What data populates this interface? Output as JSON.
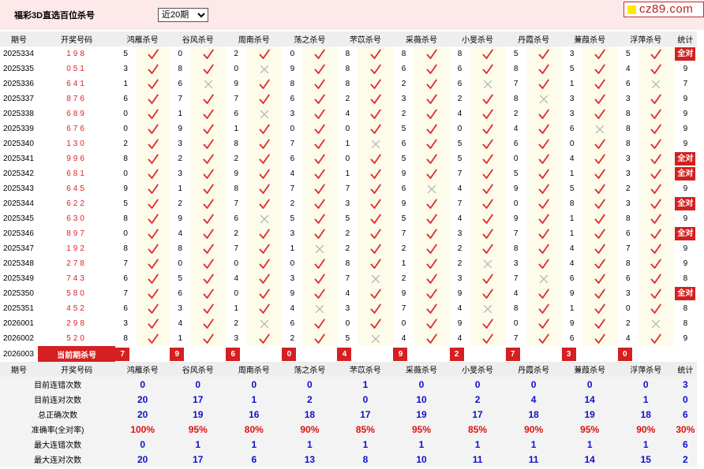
{
  "header": {
    "title": "福彩3D直选百位杀号",
    "range_selected": "近20期",
    "site": "cz89.com"
  },
  "columns": [
    "期号",
    "开奖号码",
    "鸿雁杀号",
    "谷风杀号",
    "周南杀号",
    "荡之杀号",
    "芣苡杀号",
    "采薇杀号",
    "小旻杀号",
    "丹霞杀号",
    "蒹葭杀号",
    "浮萍杀号",
    "统计"
  ],
  "rows": [
    {
      "period": "2025334",
      "code": "198",
      "kills": [
        [
          5,
          1
        ],
        [
          0,
          1
        ],
        [
          2,
          1
        ],
        [
          0,
          1
        ],
        [
          8,
          1
        ],
        [
          8,
          1
        ],
        [
          8,
          1
        ],
        [
          5,
          1
        ],
        [
          3,
          1
        ],
        [
          5,
          1
        ]
      ],
      "stat": "全对"
    },
    {
      "period": "2025335",
      "code": "051",
      "kills": [
        [
          3,
          1
        ],
        [
          8,
          1
        ],
        [
          0,
          0
        ],
        [
          9,
          1
        ],
        [
          8,
          1
        ],
        [
          6,
          1
        ],
        [
          6,
          1
        ],
        [
          8,
          1
        ],
        [
          5,
          1
        ],
        [
          4,
          1
        ]
      ],
      "stat": "9"
    },
    {
      "period": "2025336",
      "code": "641",
      "kills": [
        [
          1,
          1
        ],
        [
          6,
          0
        ],
        [
          9,
          1
        ],
        [
          8,
          1
        ],
        [
          8,
          1
        ],
        [
          2,
          1
        ],
        [
          6,
          0
        ],
        [
          7,
          1
        ],
        [
          1,
          1
        ],
        [
          6,
          0
        ]
      ],
      "stat": "7"
    },
    {
      "period": "2025337",
      "code": "876",
      "kills": [
        [
          6,
          1
        ],
        [
          7,
          1
        ],
        [
          7,
          1
        ],
        [
          6,
          1
        ],
        [
          2,
          1
        ],
        [
          3,
          1
        ],
        [
          2,
          1
        ],
        [
          8,
          0
        ],
        [
          3,
          1
        ],
        [
          3,
          1
        ]
      ],
      "stat": "9"
    },
    {
      "period": "2025338",
      "code": "689",
      "kills": [
        [
          0,
          1
        ],
        [
          1,
          1
        ],
        [
          6,
          0
        ],
        [
          3,
          1
        ],
        [
          4,
          1
        ],
        [
          2,
          1
        ],
        [
          4,
          1
        ],
        [
          2,
          1
        ],
        [
          3,
          1
        ],
        [
          8,
          1
        ]
      ],
      "stat": "9"
    },
    {
      "period": "2025339",
      "code": "676",
      "kills": [
        [
          0,
          1
        ],
        [
          9,
          1
        ],
        [
          1,
          1
        ],
        [
          0,
          1
        ],
        [
          0,
          1
        ],
        [
          5,
          1
        ],
        [
          0,
          1
        ],
        [
          4,
          1
        ],
        [
          6,
          0
        ],
        [
          8,
          1
        ]
      ],
      "stat": "9"
    },
    {
      "period": "2025340",
      "code": "130",
      "kills": [
        [
          2,
          1
        ],
        [
          3,
          1
        ],
        [
          8,
          1
        ],
        [
          7,
          1
        ],
        [
          1,
          0
        ],
        [
          6,
          1
        ],
        [
          5,
          1
        ],
        [
          6,
          1
        ],
        [
          0,
          1
        ],
        [
          8,
          1
        ]
      ],
      "stat": "9"
    },
    {
      "period": "2025341",
      "code": "996",
      "kills": [
        [
          8,
          1
        ],
        [
          2,
          1
        ],
        [
          2,
          1
        ],
        [
          6,
          1
        ],
        [
          0,
          1
        ],
        [
          5,
          1
        ],
        [
          5,
          1
        ],
        [
          0,
          1
        ],
        [
          4,
          1
        ],
        [
          3,
          1
        ]
      ],
      "stat": "全对"
    },
    {
      "period": "2025342",
      "code": "681",
      "kills": [
        [
          0,
          1
        ],
        [
          3,
          1
        ],
        [
          9,
          1
        ],
        [
          4,
          1
        ],
        [
          1,
          1
        ],
        [
          9,
          1
        ],
        [
          7,
          1
        ],
        [
          5,
          1
        ],
        [
          1,
          1
        ],
        [
          3,
          1
        ]
      ],
      "stat": "全对"
    },
    {
      "period": "2025343",
      "code": "645",
      "kills": [
        [
          9,
          1
        ],
        [
          1,
          1
        ],
        [
          8,
          1
        ],
        [
          7,
          1
        ],
        [
          7,
          1
        ],
        [
          6,
          0
        ],
        [
          4,
          1
        ],
        [
          9,
          1
        ],
        [
          5,
          1
        ],
        [
          2,
          1
        ]
      ],
      "stat": "9"
    },
    {
      "period": "2025344",
      "code": "622",
      "kills": [
        [
          5,
          1
        ],
        [
          2,
          1
        ],
        [
          7,
          1
        ],
        [
          2,
          1
        ],
        [
          3,
          1
        ],
        [
          9,
          1
        ],
        [
          7,
          1
        ],
        [
          0,
          1
        ],
        [
          8,
          1
        ],
        [
          3,
          1
        ]
      ],
      "stat": "全对"
    },
    {
      "period": "2025345",
      "code": "630",
      "kills": [
        [
          8,
          1
        ],
        [
          9,
          1
        ],
        [
          6,
          0
        ],
        [
          5,
          1
        ],
        [
          5,
          1
        ],
        [
          5,
          1
        ],
        [
          4,
          1
        ],
        [
          9,
          1
        ],
        [
          1,
          1
        ],
        [
          8,
          1
        ]
      ],
      "stat": "9"
    },
    {
      "period": "2025346",
      "code": "897",
      "kills": [
        [
          0,
          1
        ],
        [
          4,
          1
        ],
        [
          2,
          1
        ],
        [
          3,
          1
        ],
        [
          2,
          1
        ],
        [
          7,
          1
        ],
        [
          3,
          1
        ],
        [
          7,
          1
        ],
        [
          1,
          1
        ],
        [
          6,
          1
        ]
      ],
      "stat": "全对"
    },
    {
      "period": "2025347",
      "code": "192",
      "kills": [
        [
          8,
          1
        ],
        [
          8,
          1
        ],
        [
          7,
          1
        ],
        [
          1,
          0
        ],
        [
          2,
          1
        ],
        [
          2,
          1
        ],
        [
          2,
          1
        ],
        [
          8,
          1
        ],
        [
          4,
          1
        ],
        [
          7,
          1
        ]
      ],
      "stat": "9"
    },
    {
      "period": "2025348",
      "code": "278",
      "kills": [
        [
          7,
          1
        ],
        [
          0,
          1
        ],
        [
          0,
          1
        ],
        [
          0,
          1
        ],
        [
          8,
          1
        ],
        [
          1,
          1
        ],
        [
          2,
          0
        ],
        [
          3,
          1
        ],
        [
          4,
          1
        ],
        [
          8,
          1
        ]
      ],
      "stat": "9"
    },
    {
      "period": "2025349",
      "code": "743",
      "kills": [
        [
          6,
          1
        ],
        [
          5,
          1
        ],
        [
          4,
          1
        ],
        [
          3,
          1
        ],
        [
          7,
          0
        ],
        [
          2,
          1
        ],
        [
          3,
          1
        ],
        [
          7,
          0
        ],
        [
          6,
          1
        ],
        [
          6,
          1
        ]
      ],
      "stat": "8"
    },
    {
      "period": "2025350",
      "code": "580",
      "kills": [
        [
          7,
          1
        ],
        [
          6,
          1
        ],
        [
          0,
          1
        ],
        [
          9,
          1
        ],
        [
          4,
          1
        ],
        [
          9,
          1
        ],
        [
          9,
          1
        ],
        [
          4,
          1
        ],
        [
          9,
          1
        ],
        [
          3,
          1
        ]
      ],
      "stat": "全对"
    },
    {
      "period": "2025351",
      "code": "452",
      "kills": [
        [
          6,
          1
        ],
        [
          3,
          1
        ],
        [
          1,
          1
        ],
        [
          4,
          0
        ],
        [
          3,
          1
        ],
        [
          7,
          1
        ],
        [
          4,
          0
        ],
        [
          8,
          1
        ],
        [
          1,
          1
        ],
        [
          0,
          1
        ]
      ],
      "stat": "8"
    },
    {
      "period": "2026001",
      "code": "298",
      "kills": [
        [
          3,
          1
        ],
        [
          4,
          1
        ],
        [
          2,
          0
        ],
        [
          6,
          1
        ],
        [
          0,
          1
        ],
        [
          0,
          1
        ],
        [
          9,
          1
        ],
        [
          0,
          1
        ],
        [
          9,
          1
        ],
        [
          2,
          0
        ]
      ],
      "stat": "8"
    },
    {
      "period": "2026002",
      "code": "520",
      "kills": [
        [
          8,
          1
        ],
        [
          1,
          1
        ],
        [
          3,
          1
        ],
        [
          2,
          1
        ],
        [
          5,
          0
        ],
        [
          4,
          1
        ],
        [
          4,
          1
        ],
        [
          7,
          1
        ],
        [
          6,
          1
        ],
        [
          4,
          1
        ]
      ],
      "stat": "9"
    }
  ],
  "current": {
    "period": "2026003",
    "label": "当前期杀号",
    "kills": [
      "7",
      "9",
      "6",
      "0",
      "4",
      "9",
      "2",
      "7",
      "3",
      "0"
    ]
  },
  "stats": [
    {
      "label": "目前连错次数",
      "values": [
        "0",
        "0",
        "0",
        "0",
        "1",
        "0",
        "0",
        "0",
        "0",
        "0",
        "3"
      ]
    },
    {
      "label": "目前连对次数",
      "values": [
        "20",
        "17",
        "1",
        "2",
        "0",
        "10",
        "2",
        "4",
        "14",
        "1",
        "0"
      ]
    },
    {
      "label": "总正确次数",
      "values": [
        "20",
        "19",
        "16",
        "18",
        "17",
        "19",
        "17",
        "18",
        "19",
        "18",
        "6"
      ]
    },
    {
      "label": "准确率(全对率)",
      "values": [
        "100%",
        "95%",
        "80%",
        "90%",
        "85%",
        "95%",
        "85%",
        "90%",
        "95%",
        "90%",
        "30%"
      ],
      "red": true
    },
    {
      "label": "最大连错次数",
      "values": [
        "0",
        "1",
        "1",
        "1",
        "1",
        "1",
        "1",
        "1",
        "1",
        "1",
        "6"
      ]
    },
    {
      "label": "最大连对次数",
      "values": [
        "20",
        "17",
        "6",
        "13",
        "8",
        "10",
        "11",
        "11",
        "14",
        "15",
        "2"
      ]
    }
  ],
  "colors": {
    "check": "#e03030",
    "cross": "#b8b8b8",
    "accent": "#d42020",
    "stat_value": "#1010c8"
  }
}
